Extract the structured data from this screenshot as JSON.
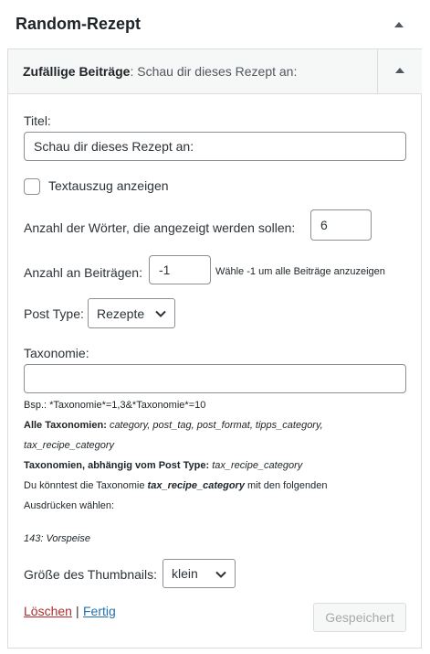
{
  "panel": {
    "title": "Random-Rezept",
    "toggle_icon": "triangle-up-icon"
  },
  "widget": {
    "title_bold": "Zufällige Beiträge",
    "title_rest": ": Schau dir dieses Rezept an:",
    "toggle_icon": "triangle-up-icon"
  },
  "form": {
    "title_label": "Titel:",
    "title_value": "Schau dir dieses Rezept an:",
    "excerpt_label": "Textauszug anzeigen",
    "excerpt_checked": false,
    "words_label": "Anzahl der Wörter, die angezeigt werden sollen:",
    "words_value": "6",
    "posts_label": "Anzahl an Beiträgen:",
    "posts_value": "-1",
    "posts_hint": "Wähle -1 um alle Beiträge anzuzeigen",
    "post_type_label": "Post Type:",
    "post_type_value": "Rezepte",
    "taxonomy_label": "Taxonomie:",
    "taxonomy_value": "",
    "example": "Bsp.: *Taxonomie*=1,3&*Taxonomie*=10",
    "all_tax_label": "Alle Taxonomien:",
    "all_tax_values_line1": "category, post_tag, post_format, tipps_category,",
    "all_tax_values_line2": "tax_recipe_category",
    "dep_tax_label": "Taxonomien, abhängig vom Post Type:",
    "dep_tax_value": "tax_recipe_category",
    "choose_prefix": "Du könntest die Taxonomie ",
    "choose_tax": "tax_recipe_category",
    "choose_suffix": " mit den folgenden",
    "choose_line2": "Ausdrücken wählen:",
    "term": "143: Vorspeise",
    "thumb_label": "Größe des Thumbnails:",
    "thumb_value": "klein"
  },
  "footer": {
    "delete_label": "Löschen",
    "separator": "|",
    "done_label": "Fertig",
    "save_label": "Gespeichert"
  }
}
